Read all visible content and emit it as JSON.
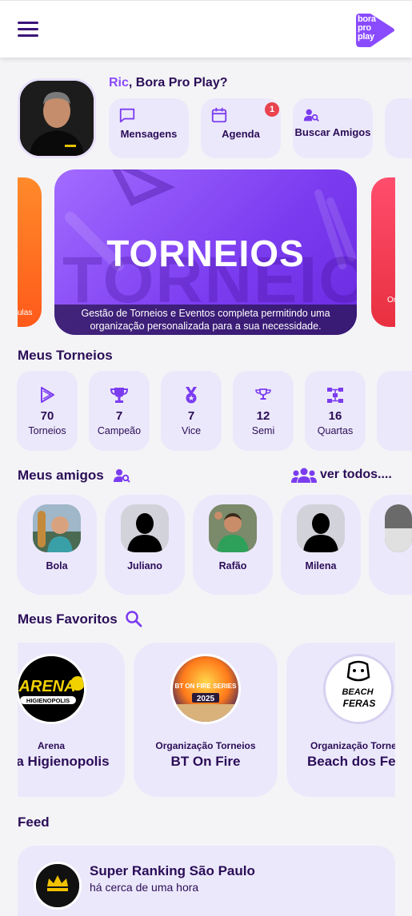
{
  "app": {
    "logo_text_1": "bora",
    "logo_text_2": "pro",
    "logo_text_3": "play"
  },
  "profile": {
    "user_name": "Ric",
    "greeting_suffix": ", Bora Pro Play?"
  },
  "quick_actions": [
    {
      "label": "Mensagens",
      "icon": "chat-icon"
    },
    {
      "label": "Agenda",
      "icon": "calendar-icon",
      "badge": "1"
    },
    {
      "label": "Buscar Amigos",
      "icon": "user-search-icon"
    }
  ],
  "banner": {
    "title": "TORNEIOS",
    "bg_text": "TORNEIOS",
    "caption_line1": "Gestão de Torneios e Eventos completa permitindo uma",
    "caption_line2": "organização personalizada para a sua necessidade.",
    "left_peek_text": "ulas",
    "right_peek_text": "Or"
  },
  "tournaments": {
    "title": "Meus Torneios",
    "stats": [
      {
        "value": "70",
        "label": "Torneios",
        "icon": "play-icon"
      },
      {
        "value": "7",
        "label": "Campeão",
        "icon": "trophy-icon"
      },
      {
        "value": "7",
        "label": "Vice",
        "icon": "medal-icon"
      },
      {
        "value": "12",
        "label": "Semi",
        "icon": "semi-trophy-icon"
      },
      {
        "value": "16",
        "label": "Quartas",
        "icon": "bracket-icon"
      }
    ]
  },
  "friends": {
    "title": "Meus amigos",
    "see_all": "ver todos....",
    "items": [
      {
        "name": "Bola"
      },
      {
        "name": "Juliano"
      },
      {
        "name": "Rafão"
      },
      {
        "name": "Milena"
      }
    ]
  },
  "favorites": {
    "title": "Meus Favoritos",
    "items": [
      {
        "type": "Arena",
        "name": "na Higienopolis",
        "logo_word": "ARENA",
        "logo_sub": "HIGIENOPOLIS"
      },
      {
        "type": "Organização Torneios",
        "name": "BT On Fire",
        "logo_word": "BT ON FIRE SERIES",
        "logo_sub": "2025"
      },
      {
        "type": "Organização Tornei",
        "name": "Beach dos Fer",
        "logo_word": "BEACH",
        "logo_sub": "FERAS"
      }
    ]
  },
  "feed": {
    "title": "Feed",
    "items": [
      {
        "title": "Super Ranking São Paulo",
        "time": "há cerca de uma hora"
      }
    ]
  },
  "colors": {
    "accent": "#8a4bff",
    "primary_text": "#2a0d57",
    "card_bg": "#ece8fb",
    "badge": "#e8434f"
  }
}
